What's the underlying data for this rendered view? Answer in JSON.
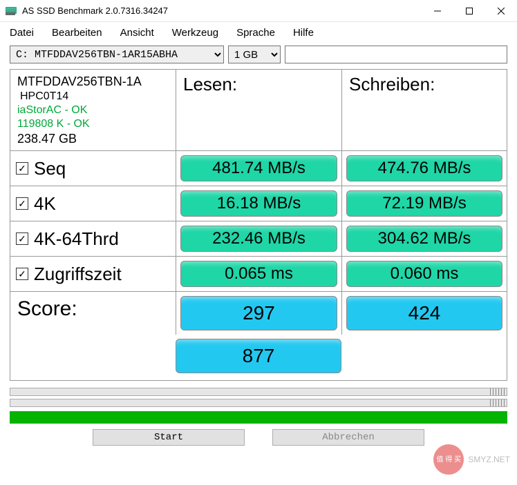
{
  "window": {
    "title": "AS SSD Benchmark 2.0.7316.34247"
  },
  "menu": {
    "datei": "Datei",
    "bearbeiten": "Bearbeiten",
    "ansicht": "Ansicht",
    "werkzeug": "Werkzeug",
    "sprache": "Sprache",
    "hilfe": "Hilfe"
  },
  "controls": {
    "drive": "C: MTFDDAV256TBN-1AR15ABHA",
    "size": "1 GB",
    "filter": ""
  },
  "info": {
    "model": "MTFDDAV256TBN-1A",
    "fw": "HPC0T14",
    "driver": "iaStorAC - OK",
    "align": "119808 K - OK",
    "capacity": "238.47 GB"
  },
  "headers": {
    "read": "Lesen:",
    "write": "Schreiben:"
  },
  "rows": {
    "seq": {
      "label": "Seq",
      "read": "481.74 MB/s",
      "write": "474.76 MB/s"
    },
    "k4": {
      "label": "4K",
      "read": "16.18 MB/s",
      "write": "72.19 MB/s"
    },
    "k4t": {
      "label": "4K-64Thrd",
      "read": "232.46 MB/s",
      "write": "304.62 MB/s"
    },
    "acc": {
      "label": "Zugriffszeit",
      "read": "0.065 ms",
      "write": "0.060 ms"
    }
  },
  "score": {
    "label": "Score:",
    "read": "297",
    "write": "424",
    "total": "877"
  },
  "buttons": {
    "start": "Start",
    "abort": "Abbrechen"
  },
  "watermark": {
    "circle": "值\n得\n买",
    "text": "SMYZ.NET"
  }
}
